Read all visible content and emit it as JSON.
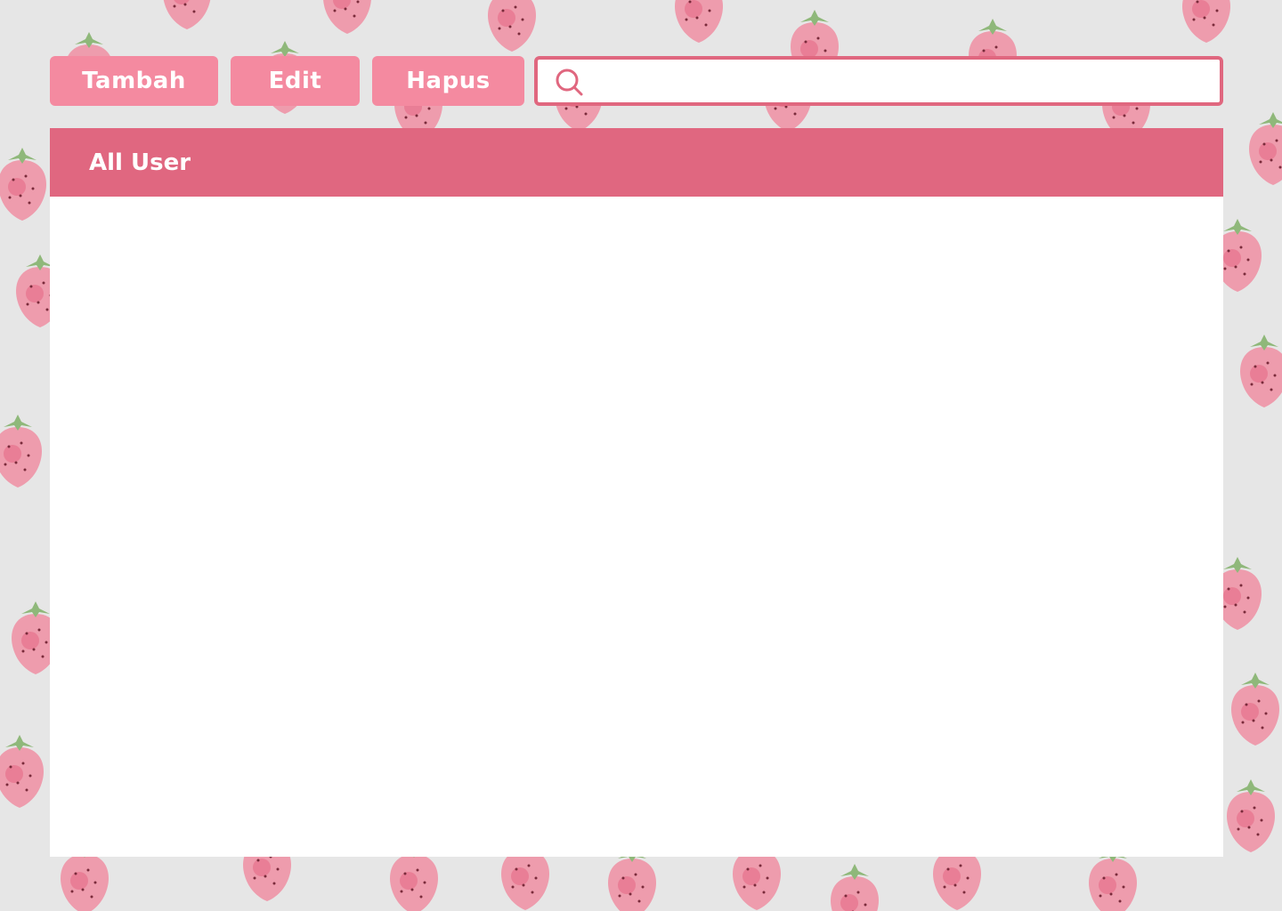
{
  "toolbar": {
    "add_label": "Tambah",
    "edit_label": "Edit",
    "delete_label": "Hapus"
  },
  "search": {
    "value": "",
    "placeholder": "",
    "icon": "search-icon"
  },
  "panel": {
    "title": "All User",
    "rows": []
  },
  "colors": {
    "button_bg": "#f48aa0",
    "accent": "#e06780",
    "background": "#e6e6e6",
    "panel_bg": "#ffffff",
    "strawberry": "#ee8fa1",
    "leaf": "#8fb87a"
  }
}
